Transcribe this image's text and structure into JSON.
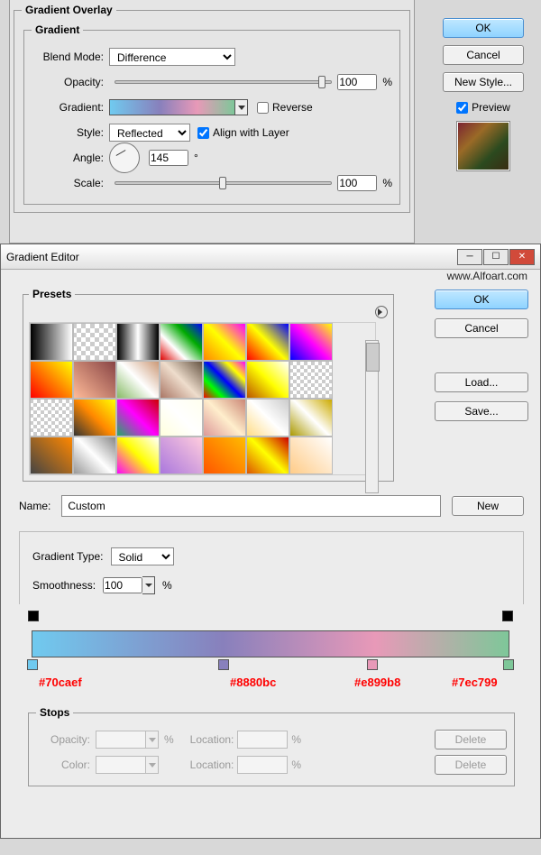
{
  "layerStyle": {
    "title": "Gradient Overlay",
    "inner": "Gradient",
    "labels": {
      "blendMode": "Blend Mode:",
      "opacity": "Opacity:",
      "gradient": "Gradient:",
      "style": "Style:",
      "angle": "Angle:",
      "scale": "Scale:",
      "percent": "%",
      "degree": "°",
      "reverse": "Reverse",
      "align": "Align with Layer"
    },
    "values": {
      "blendMode": "Difference",
      "opacity": "100",
      "style": "Reflected",
      "angle": "145",
      "scale": "100",
      "reverseChecked": false,
      "alignChecked": true
    },
    "buttons": {
      "ok": "OK",
      "cancel": "Cancel",
      "newStyle": "New Style...",
      "preview": "Preview"
    }
  },
  "gradientEditor": {
    "title": "Gradient Editor",
    "presets": "Presets",
    "name": {
      "label": "Name:",
      "value": "Custom"
    },
    "buttons": {
      "ok": "OK",
      "cancel": "Cancel",
      "load": "Load...",
      "save": "Save...",
      "new": "New",
      "delete": "Delete"
    },
    "gradientType": {
      "label": "Gradient Type:",
      "value": "Solid"
    },
    "smoothness": {
      "label": "Smoothness:",
      "value": "100",
      "percent": "%"
    },
    "stops": {
      "label": "Stops",
      "opacity": "Opacity:",
      "color": "Color:",
      "location": "Location:",
      "percent": "%"
    },
    "colorStops": [
      {
        "hex": "#70caef",
        "pos": 0
      },
      {
        "hex": "#8880bc",
        "pos": 40
      },
      {
        "hex": "#e899b8",
        "pos": 72
      },
      {
        "hex": "#7ec799",
        "pos": 100
      }
    ]
  },
  "watermark": "www.Alfoart.com"
}
